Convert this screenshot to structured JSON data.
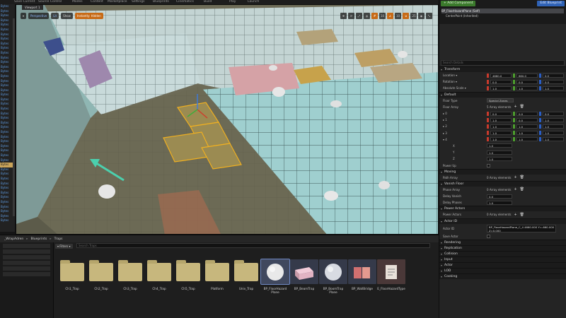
{
  "menu": [
    "Save Current",
    "Source Control",
    "Modes",
    "Content",
    "Marketplace",
    "Settings",
    "Blueprints",
    "Cinematics",
    "Build",
    "Play",
    "Launch"
  ],
  "viewport": {
    "tab": "Viewport 1",
    "perspective": "Perspective",
    "lit": "Lit",
    "show": "Show",
    "mode": "Instantly: Hidden"
  },
  "outliner": {
    "rows": [
      "Bytes",
      "Bytes",
      "Bytes",
      "Bytes",
      "Bytes",
      "Bytes",
      "Bytes",
      "Bytes",
      "Bytes",
      "Bytes",
      "Bytes",
      "Bytes",
      "Bytes",
      "Bytes",
      "Bytes",
      "Bytes",
      "Bytes",
      "Bytes",
      "Bytes",
      "Bytes",
      "Bytes",
      "Bytes",
      "Bytes",
      "Bytes",
      "Bytes",
      "Bytes",
      "Bytes",
      "Bytes",
      "Bytes",
      "Bytes",
      "Bytes",
      "Bytes",
      "Bytes",
      "Bytes",
      "Bytes",
      "Bytes",
      "Bytes",
      "Bytes",
      "Bytes",
      "Bytes",
      "Bytes",
      "Bytes",
      "Bytes",
      "Bytes",
      "Bytes",
      "Bytes",
      "Bytes"
    ],
    "selected_index": 34
  },
  "details": {
    "add_component": "+ Add Component",
    "edit_blueprint": "Edit Blueprint",
    "component_root": "BP_FloorHazardPlane (Self)",
    "component_child": "CenterPoint (Inherited)",
    "search_placeholder": "Search Details",
    "sections": {
      "transform": "Transform",
      "default": "Default",
      "moving": "Moving",
      "vanish": "Vanish Floor",
      "power": "Power Actors",
      "actor_id": "Actor ID",
      "rendering": "Rendering",
      "replication": "Replication",
      "collision": "Collision",
      "input": "Input",
      "actor": "Actor",
      "lod": "LOD",
      "cooking": "Cooking"
    },
    "transform": {
      "location_label": "Location ▾",
      "location": [
        "4660.0",
        "660.0",
        "0.0"
      ],
      "rotation_label": "Rotation ▾",
      "rotation": [
        "0.0",
        "0.0",
        "0.0"
      ],
      "scale_label": "Absolute Scale ▾",
      "scale": [
        "1.0",
        "1.0",
        "1.0"
      ]
    },
    "default": {
      "floor_type_label": "Floor Type",
      "floor_type": "Special Zones",
      "floor_array_label": "Floor Array",
      "floor_array": "5 Array elements",
      "elements": [
        {
          "label": "▸ 0",
          "v": [
            "0.0",
            "0.0",
            "0.0"
          ]
        },
        {
          "label": "▸ 1",
          "v": [
            "1.0",
            "0.0",
            "1.0"
          ]
        },
        {
          "label": "▸ 2",
          "v": [
            "1.0",
            "1.0",
            "1.0"
          ]
        },
        {
          "label": "▸ 3",
          "v": [
            "1.0",
            "1.0",
            "1.0"
          ]
        },
        {
          "label": "▾ 4",
          "v": [
            "1.0",
            "1.0",
            "1.0"
          ]
        }
      ],
      "sub": [
        {
          "label": "X",
          "v": "1.0"
        },
        {
          "label": "Y",
          "v": "1.0"
        },
        {
          "label": "Z",
          "v": "1.0"
        }
      ],
      "power_up_label": "Power Up"
    },
    "moving": {
      "path_array_label": "Path Array",
      "path_array": "0 Array elements"
    },
    "vanish": {
      "phase_array_label": "Phase Array",
      "phase_array": "0 Array elements",
      "delay_vanish_label": "Delay Vanish",
      "delay_vanish": "0.0",
      "delay_phases_label": "Delay Phases",
      "delay_phases": "1.0"
    },
    "power": {
      "power_actors_label": "Power Actors",
      "power_actors": "0 Array elements"
    },
    "actor_id": {
      "label": "Actor ID",
      "value": "BP_FloorHazardPlane_C_4 4660.000 Y=-660.000 Z=0.000",
      "save_actor_label": "Save Actor"
    }
  },
  "content_browser": {
    "path": [
      "_WrapAdren",
      "Blueprints",
      "Traps"
    ],
    "filters": "▾ Filters ▾",
    "search_placeholder": "Search Traps",
    "assets": [
      {
        "name": "Ch1_Trap",
        "kind": "folder"
      },
      {
        "name": "Ch2_Trap",
        "kind": "folder"
      },
      {
        "name": "Ch3_Trap",
        "kind": "folder"
      },
      {
        "name": "Ch4_Trap",
        "kind": "folder"
      },
      {
        "name": "Ch5_Trap",
        "kind": "folder"
      },
      {
        "name": "Platform",
        "kind": "folder"
      },
      {
        "name": "Univ_Trap",
        "kind": "folder"
      },
      {
        "name": "BP_FloorHazard Plane",
        "kind": "sphere-white"
      },
      {
        "name": "BP_BeamTrap",
        "kind": "box-pink"
      },
      {
        "name": "BP_BoomTrap Plane",
        "kind": "sphere-white"
      },
      {
        "name": "BP_WallBridge",
        "kind": "box-red"
      },
      {
        "name": "E_FloorHazardType",
        "kind": "doc"
      }
    ]
  },
  "colors": {
    "accent_orange": "#c76a16",
    "add_green": "#3b7a2c",
    "blueprint_blue": "#2f62b6",
    "selection_gold": "#caa45a"
  }
}
